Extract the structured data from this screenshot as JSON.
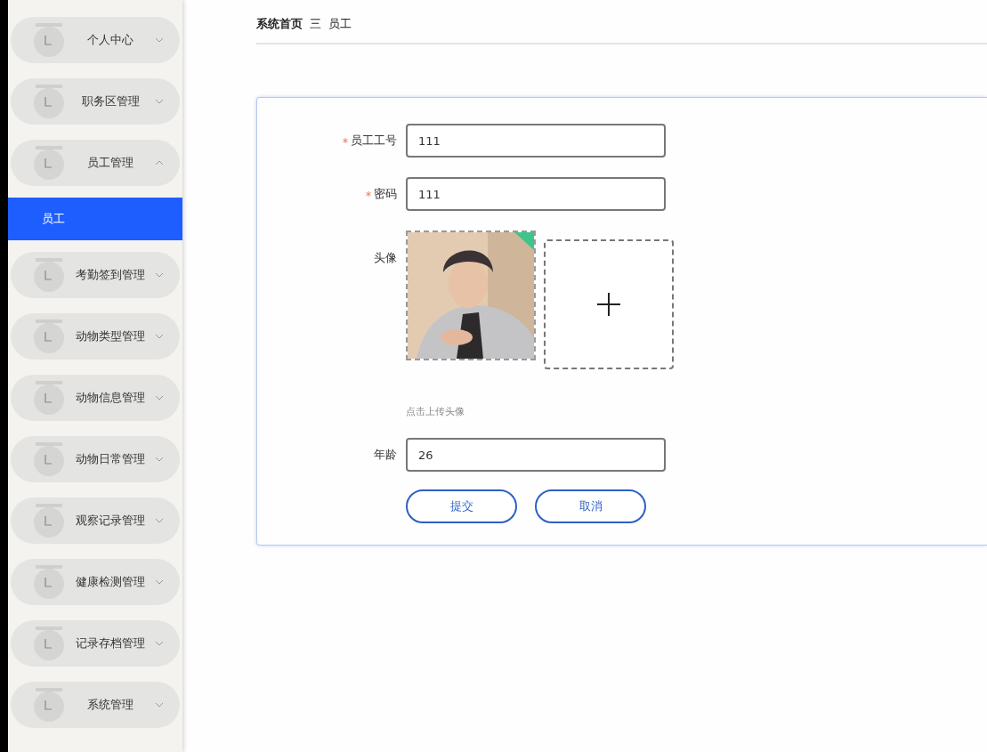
{
  "sidebar": {
    "items": [
      {
        "label": "个人中心",
        "expanded": false
      },
      {
        "label": "职务区管理",
        "expanded": false
      },
      {
        "label": "员工管理",
        "expanded": true,
        "children": [
          {
            "label": "员工",
            "selected": true
          }
        ]
      },
      {
        "label": "考勤签到管理",
        "expanded": false
      },
      {
        "label": "动物类型管理",
        "expanded": false
      },
      {
        "label": "动物信息管理",
        "expanded": false
      },
      {
        "label": "动物日常管理",
        "expanded": false
      },
      {
        "label": "观察记录管理",
        "expanded": false
      },
      {
        "label": "健康检测管理",
        "expanded": false
      },
      {
        "label": "记录存档管理",
        "expanded": false
      },
      {
        "label": "系统管理",
        "expanded": false
      }
    ]
  },
  "breadcrumb": {
    "items": [
      "系统首页",
      "员工"
    ],
    "separator": "三"
  },
  "form": {
    "fields": [
      {
        "kind": "text",
        "label": "员工工号",
        "required": true,
        "value": "111"
      },
      {
        "kind": "text",
        "label": "密码",
        "required": true,
        "value": "111"
      },
      {
        "label": "头像",
        "required": false,
        "hint": "点击上传头像"
      },
      {
        "kind": "text",
        "label": "年龄",
        "required": false,
        "value": "26"
      }
    ],
    "buttons": [
      "提交",
      "取消"
    ]
  }
}
